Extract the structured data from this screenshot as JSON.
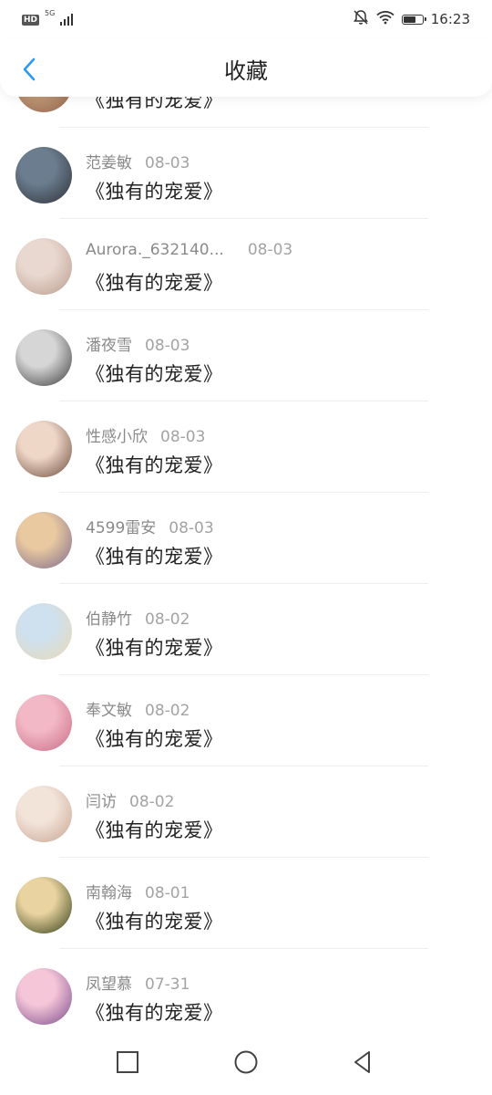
{
  "status_bar": {
    "hd": "HD",
    "network": "5G",
    "time": "16:23",
    "battery_level": 0.6
  },
  "header": {
    "title": "收藏",
    "back_icon": "chevron-left-icon",
    "accent_color": "#2b9af3"
  },
  "items": [
    {
      "name": "",
      "date": "",
      "title": "《独有的宠爱》",
      "avatar_colors": [
        "#c9a27f",
        "#8c5e45"
      ]
    },
    {
      "name": "范姜敏",
      "date": "08-03",
      "title": "《独有的宠爱》",
      "avatar_colors": [
        "#6b7d8f",
        "#2d2f36"
      ]
    },
    {
      "name": "Aurora._632140...",
      "date": "08-03",
      "title": "《独有的宠爱》",
      "avatar_colors": [
        "#e9d8cf",
        "#b99a8c"
      ]
    },
    {
      "name": "潘夜雪",
      "date": "08-03",
      "title": "《独有的宠爱》",
      "avatar_colors": [
        "#d6d6d6",
        "#3a3a3a"
      ]
    },
    {
      "name": "性感小欣",
      "date": "08-03",
      "title": "《独有的宠爱》",
      "avatar_colors": [
        "#efd7c8",
        "#6b4a3a"
      ]
    },
    {
      "name": "4599雷安",
      "date": "08-03",
      "title": "《独有的宠爱》",
      "avatar_colors": [
        "#e8c9a0",
        "#7d6a8c"
      ]
    },
    {
      "name": "伯静竹",
      "date": "08-02",
      "title": "《独有的宠爱》",
      "avatar_colors": [
        "#cfe0ee",
        "#e8d9b3"
      ]
    },
    {
      "name": "奉文敏",
      "date": "08-02",
      "title": "《独有的宠爱》",
      "avatar_colors": [
        "#f2b8c6",
        "#c96b85"
      ]
    },
    {
      "name": "闫访",
      "date": "08-02",
      "title": "《独有的宠爱》",
      "avatar_colors": [
        "#f3e4da",
        "#c7a38f"
      ]
    },
    {
      "name": "南翰海",
      "date": "08-01",
      "title": "《独有的宠爱》",
      "avatar_colors": [
        "#e9d3a0",
        "#2e3a12"
      ]
    },
    {
      "name": "凤望慕",
      "date": "07-31",
      "title": "《独有的宠爱》",
      "avatar_colors": [
        "#f5c6d8",
        "#7a4a8c"
      ]
    }
  ],
  "nav_bar": {
    "recents_icon": "square-icon",
    "home_icon": "circle-icon",
    "back_icon": "triangle-back-icon"
  }
}
